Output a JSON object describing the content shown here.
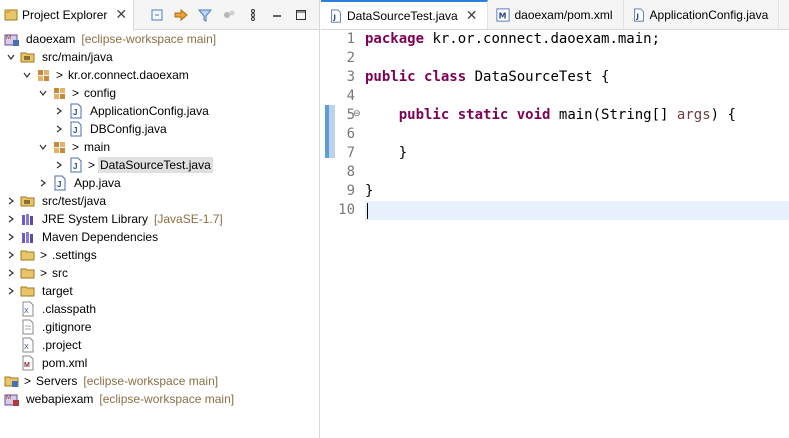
{
  "explorer": {
    "tab_label": "Project Explorer",
    "close": "✕",
    "items": [
      {
        "label": "daoexam",
        "deco": "[eclipse-workspace main]"
      },
      {
        "label": "src/main/java"
      },
      {
        "label": "kr.or.connect.daoexam",
        "prefix": ">"
      },
      {
        "label": "config",
        "prefix": ">"
      },
      {
        "label": "ApplicationConfig.java"
      },
      {
        "label": "DBConfig.java"
      },
      {
        "label": "main",
        "prefix": ">"
      },
      {
        "label": "DataSourceTest.java",
        "prefix": ">"
      },
      {
        "label": "App.java"
      },
      {
        "label": "src/test/java"
      },
      {
        "label": "JRE System Library",
        "deco": "[JavaSE-1.7]"
      },
      {
        "label": "Maven Dependencies"
      },
      {
        "label": ".settings",
        "prefix": ">"
      },
      {
        "label": "src",
        "prefix": ">"
      },
      {
        "label": "target"
      },
      {
        "label": ".classpath"
      },
      {
        "label": ".gitignore"
      },
      {
        "label": ".project"
      },
      {
        "label": "pom.xml"
      },
      {
        "label": "Servers",
        "prefix": ">",
        "deco": "[eclipse-workspace main]"
      },
      {
        "label": "webapiexam",
        "deco": "[eclipse-workspace main]"
      }
    ]
  },
  "editor": {
    "tabs": [
      {
        "label": "DataSourceTest.java",
        "close": "✕"
      },
      {
        "label": "daoexam/pom.xml"
      },
      {
        "label": "ApplicationConfig.java"
      }
    ],
    "line_numbers": [
      "1",
      "2",
      "3",
      "4",
      "5",
      "6",
      "7",
      "8",
      "9",
      "10"
    ],
    "code": {
      "l1_kw": "package",
      "l1_rest": " kr.or.connect.daoexam.main;",
      "l3_kw1": "public",
      "l3_kw2": "class",
      "l3_rest": " DataSourceTest {",
      "l5_indent": "    ",
      "l5_kw1": "public",
      "l5_kw2": "static",
      "l5_kw3": "void",
      "l5_mid": " main(String[] ",
      "l5_param": "args",
      "l5_end": ") {",
      "l7": "    }",
      "l9": "}"
    },
    "fold_marker": "⊖"
  },
  "colors": {
    "keyword": "#7f0055",
    "decoration": "#8b6f47",
    "current_line": "#e8f2fe",
    "active_tab_accent": "#2a7fd6"
  }
}
